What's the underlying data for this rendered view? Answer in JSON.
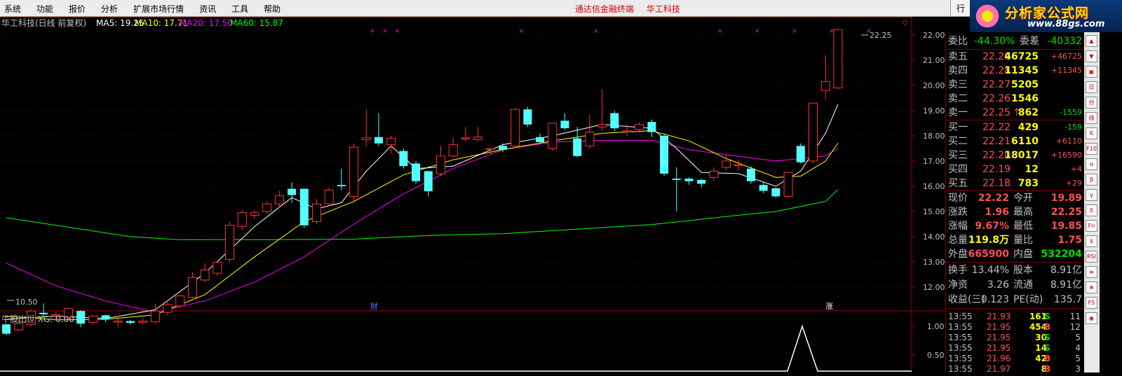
{
  "menu": {
    "items": [
      "系统",
      "功能",
      "报价",
      "分析",
      "扩展市场行情",
      "资讯",
      "工具",
      "帮助"
    ],
    "center_title": [
      "通达信金融终端",
      "华工科技"
    ],
    "right_button": "行"
  },
  "logo": {
    "name": "分析家公式网",
    "url": "www.88gs.com"
  },
  "chart": {
    "stock_title": "华工科技(日线 前复权)",
    "ma": [
      {
        "label": "MA5: 19.25",
        "color": "#ffffff"
      },
      {
        "label": "MA10: 17.71",
        "color": "#ffff00"
      },
      {
        "label": "MA20: 17.50",
        "color": "#ff00ff"
      },
      {
        "label": "MA60: 15.87",
        "color": "#00ff00"
      }
    ],
    "high_label": "22.25",
    "low_label": "10.50",
    "marker_cai": "财",
    "marker_zhang": "涨",
    "y_axis": [
      "22.00",
      "21.00",
      "20.00",
      "19.00",
      "18.00",
      "17.00",
      "16.00",
      "15.00",
      "14.00",
      "13.00",
      "12.00"
    ],
    "indicator_title": "牛股出世  XG: 0.00",
    "indicator_axis": [
      "1.00",
      "0.50"
    ]
  },
  "chart_data": {
    "type": "candlestick",
    "y_range": [
      10.0,
      22.4
    ],
    "candles": [
      [
        10.52,
        10.15,
        10.55,
        10.1
      ],
      [
        10.3,
        10.55,
        10.7,
        10.25
      ],
      [
        10.52,
        11.05,
        11.1,
        10.45
      ],
      [
        10.98,
        10.92,
        11.35,
        10.8
      ],
      [
        10.9,
        10.9,
        11.0,
        10.7
      ],
      [
        10.78,
        11.15,
        11.18,
        10.7
      ],
      [
        11.05,
        10.55,
        11.1,
        10.4
      ],
      [
        10.6,
        10.85,
        10.9,
        10.5
      ],
      [
        10.88,
        10.72,
        10.9,
        10.6
      ],
      [
        10.65,
        10.65,
        10.85,
        10.4
      ],
      [
        10.65,
        10.58,
        10.7,
        10.5
      ],
      [
        10.6,
        10.65,
        10.75,
        10.5
      ],
      [
        10.62,
        11.05,
        11.35,
        10.55
      ],
      [
        11.0,
        11.3,
        11.4,
        10.9
      ],
      [
        11.25,
        11.65,
        11.7,
        11.2
      ],
      [
        11.6,
        12.38,
        12.6,
        11.55
      ],
      [
        12.28,
        12.68,
        12.95,
        12.2
      ],
      [
        12.55,
        12.98,
        13.05,
        12.45
      ],
      [
        13.1,
        14.45,
        14.6,
        13.0
      ],
      [
        14.4,
        14.95,
        15.05,
        14.25
      ],
      [
        14.85,
        14.95,
        15.05,
        14.7
      ],
      [
        15.0,
        15.3,
        15.4,
        14.9
      ],
      [
        15.3,
        15.62,
        15.82,
        15.15
      ],
      [
        15.9,
        15.65,
        16.15,
        15.35
      ],
      [
        15.9,
        14.45,
        15.9,
        14.35
      ],
      [
        14.6,
        15.3,
        15.5,
        14.5
      ],
      [
        15.3,
        15.85,
        15.95,
        15.2
      ],
      [
        16.05,
        16.0,
        16.7,
        15.85
      ],
      [
        15.6,
        17.55,
        17.7,
        15.3
      ],
      [
        17.85,
        17.92,
        19.05,
        17.6
      ],
      [
        17.95,
        17.7,
        18.9,
        17.6
      ],
      [
        17.65,
        17.9,
        18.0,
        17.3
      ],
      [
        17.4,
        16.8,
        17.5,
        16.7
      ],
      [
        16.9,
        16.2,
        17.0,
        16.1
      ],
      [
        16.6,
        15.8,
        16.6,
        15.6
      ],
      [
        16.5,
        17.2,
        17.6,
        16.4
      ],
      [
        17.2,
        17.65,
        17.9,
        17.15
      ],
      [
        17.92,
        17.92,
        18.35,
        17.78
      ],
      [
        17.85,
        17.95,
        18.35,
        17.78
      ],
      [
        17.5,
        17.5,
        17.5,
        17.3
      ],
      [
        17.6,
        17.45,
        17.7,
        17.35
      ],
      [
        17.6,
        19.05,
        19.1,
        17.5
      ],
      [
        19.05,
        18.45,
        19.15,
        18.35
      ],
      [
        17.95,
        17.75,
        18.1,
        17.7
      ],
      [
        17.5,
        18.5,
        18.5,
        17.4
      ],
      [
        18.6,
        18.3,
        18.9,
        18.25
      ],
      [
        17.9,
        17.2,
        18.35,
        17.15
      ],
      [
        17.6,
        18.15,
        18.85,
        17.5
      ],
      [
        18.35,
        18.45,
        19.85,
        18.2
      ],
      [
        18.9,
        18.3,
        19.0,
        18.2
      ],
      [
        18.2,
        18.2,
        18.45,
        18.0
      ],
      [
        18.25,
        18.45,
        18.55,
        18.1
      ],
      [
        18.55,
        18.15,
        18.65,
        17.95
      ],
      [
        18.0,
        16.5,
        18.05,
        16.4
      ],
      [
        16.3,
        16.25,
        16.75,
        15.0
      ],
      [
        16.3,
        16.2,
        16.35,
        16.05
      ],
      [
        16.25,
        16.1,
        16.3,
        15.95
      ],
      [
        16.35,
        16.6,
        16.75,
        16.2
      ],
      [
        16.75,
        17.0,
        17.25,
        16.65
      ],
      [
        16.85,
        16.85,
        17.05,
        16.65
      ],
      [
        16.7,
        16.2,
        16.8,
        16.1
      ],
      [
        16.05,
        15.82,
        16.15,
        15.72
      ],
      [
        15.92,
        15.6,
        15.95,
        15.55
      ],
      [
        15.6,
        16.55,
        16.55,
        15.55
      ],
      [
        17.6,
        16.95,
        17.7,
        16.9
      ],
      [
        17.0,
        19.3,
        19.3,
        16.9
      ],
      [
        19.8,
        20.15,
        21.2,
        19.45
      ],
      [
        19.9,
        22.22,
        22.25,
        19.85
      ]
    ],
    "ma60_path": [
      [
        0,
        14.75
      ],
      [
        4,
        14.45
      ],
      [
        10,
        14.0
      ],
      [
        14,
        13.88
      ],
      [
        20,
        13.88
      ],
      [
        28,
        13.9
      ],
      [
        34,
        14.05
      ],
      [
        40,
        14.12
      ],
      [
        46,
        14.3
      ],
      [
        52,
        14.48
      ],
      [
        58,
        14.8
      ],
      [
        62,
        15.0
      ],
      [
        66,
        15.4
      ],
      [
        67,
        15.87
      ]
    ],
    "ma20_path": [
      [
        0,
        12.95
      ],
      [
        4,
        12.05
      ],
      [
        8,
        11.45
      ],
      [
        12,
        11.0
      ],
      [
        16,
        11.45
      ],
      [
        20,
        12.2
      ],
      [
        24,
        13.2
      ],
      [
        28,
        14.5
      ],
      [
        32,
        15.7
      ],
      [
        36,
        16.7
      ],
      [
        40,
        17.45
      ],
      [
        44,
        17.75
      ],
      [
        48,
        17.82
      ],
      [
        52,
        17.82
      ],
      [
        55,
        17.45
      ],
      [
        58,
        17.25
      ],
      [
        62,
        17.0
      ],
      [
        66,
        17.2
      ],
      [
        67,
        17.5
      ]
    ],
    "ma10_path": [
      [
        0,
        10.85
      ],
      [
        4,
        10.7
      ],
      [
        8,
        10.72
      ],
      [
        12,
        10.9
      ],
      [
        16,
        11.7
      ],
      [
        20,
        13.2
      ],
      [
        24,
        14.6
      ],
      [
        28,
        15.4
      ],
      [
        32,
        16.45
      ],
      [
        36,
        17.05
      ],
      [
        40,
        17.45
      ],
      [
        44,
        17.8
      ],
      [
        48,
        18.1
      ],
      [
        52,
        18.2
      ],
      [
        55,
        17.8
      ],
      [
        58,
        17.1
      ],
      [
        62,
        16.35
      ],
      [
        64,
        16.4
      ],
      [
        66,
        17.0
      ],
      [
        67,
        17.71
      ]
    ],
    "ma5_path": [
      [
        0,
        10.72
      ],
      [
        4,
        10.85
      ],
      [
        8,
        10.75
      ],
      [
        12,
        11.1
      ],
      [
        16,
        12.55
      ],
      [
        20,
        14.4
      ],
      [
        23,
        15.55
      ],
      [
        25,
        15.1
      ],
      [
        27,
        15.35
      ],
      [
        29,
        16.6
      ],
      [
        31,
        17.6
      ],
      [
        33,
        16.7
      ],
      [
        36,
        16.8
      ],
      [
        40,
        17.65
      ],
      [
        44,
        18.0
      ],
      [
        48,
        18.45
      ],
      [
        52,
        18.3
      ],
      [
        54,
        17.5
      ],
      [
        56,
        16.55
      ],
      [
        59,
        16.5
      ],
      [
        62,
        16.0
      ],
      [
        64,
        16.6
      ],
      [
        66,
        18.1
      ],
      [
        67,
        19.25
      ]
    ],
    "x_marks": [
      29,
      30,
      31,
      41,
      47,
      57,
      60,
      63,
      66,
      69
    ]
  },
  "quote": {
    "weibi": {
      "label": "委比",
      "value": "-44.30%",
      "label2": "委差",
      "value2": "-40332"
    },
    "asks": [
      {
        "label": "卖五",
        "price": "22.29",
        "vol": "46725",
        "chg": "+46725"
      },
      {
        "label": "卖四",
        "price": "22.28",
        "vol": "11345",
        "chg": "+11345"
      },
      {
        "label": "卖三",
        "price": "22.27",
        "vol": "5205",
        "chg": ""
      },
      {
        "label": "卖二",
        "price": "22.26",
        "vol": "1546",
        "chg": ""
      },
      {
        "label": "卖一",
        "price": "22.25",
        "arrow": "↑",
        "vol": "862",
        "chg": "-1559"
      }
    ],
    "bids": [
      {
        "label": "买一",
        "price": "22.22",
        "vol": "429",
        "chg": "-159"
      },
      {
        "label": "买二",
        "price": "22.21",
        "vol": "6110",
        "chg": "+6110"
      },
      {
        "label": "买三",
        "price": "22.20",
        "vol": "18017",
        "chg": "+16590"
      },
      {
        "label": "买四",
        "price": "22.19",
        "vol": "12",
        "chg": "+4"
      },
      {
        "label": "买五",
        "price": "22.18",
        "vol": "783",
        "chg": "+29"
      }
    ],
    "stats": [
      {
        "l1": "现价",
        "v1": "22.22",
        "c1": "red",
        "l2": "今开",
        "v2": "19.89",
        "c2": "red"
      },
      {
        "l1": "涨跌",
        "v1": "1.96",
        "c1": "red",
        "l2": "最高",
        "v2": "22.25",
        "c2": "red"
      },
      {
        "l1": "涨幅",
        "v1": "9.67%",
        "c1": "red",
        "l2": "最低",
        "v2": "19.85",
        "c2": "red"
      },
      {
        "l1": "总量",
        "v1": "119.8万",
        "c1": "yellow",
        "l2": "量比",
        "v2": "1.75",
        "c2": "red"
      },
      {
        "l1": "外盘",
        "v1": "665900",
        "c1": "red",
        "l2": "内盘",
        "v2": "532204",
        "c2": "green"
      }
    ],
    "stats2": [
      {
        "l1": "换手",
        "v1": "13.44%",
        "l2": "股本",
        "v2": "8.91亿"
      },
      {
        "l1": "净资",
        "v1": "3.26",
        "l2": "流通",
        "v2": "8.91亿"
      },
      {
        "l1": "收益(三)",
        "v1": "0.123",
        "l2": "PE(动)",
        "v2": "135.7"
      }
    ],
    "ticks": [
      {
        "time": "13:55",
        "price": "21.93",
        "vol": "161",
        "bs": "S",
        "n": "11"
      },
      {
        "time": "13:55",
        "price": "21.95",
        "vol": "454",
        "bs": "B",
        "n": "12"
      },
      {
        "time": "13:55",
        "price": "21.95",
        "vol": "30",
        "bs": "S",
        "n": "5"
      },
      {
        "time": "13:55",
        "price": "21.95",
        "vol": "14",
        "bs": "S",
        "n": "4"
      },
      {
        "time": "13:55",
        "price": "21.96",
        "vol": "42",
        "bs": "B",
        "n": "5"
      },
      {
        "time": "13:55",
        "price": "21.97",
        "vol": "8",
        "bs": "B",
        "n": "3"
      }
    ]
  },
  "toolbar": [
    "▲",
    "▼",
    "▣",
    "日",
    "分",
    "线",
    "K",
    "F10",
    "α",
    "β",
    "γ",
    "δ",
    "Fn",
    "$",
    "RSI",
    "≡",
    "⊕",
    "F5",
    "◉"
  ]
}
